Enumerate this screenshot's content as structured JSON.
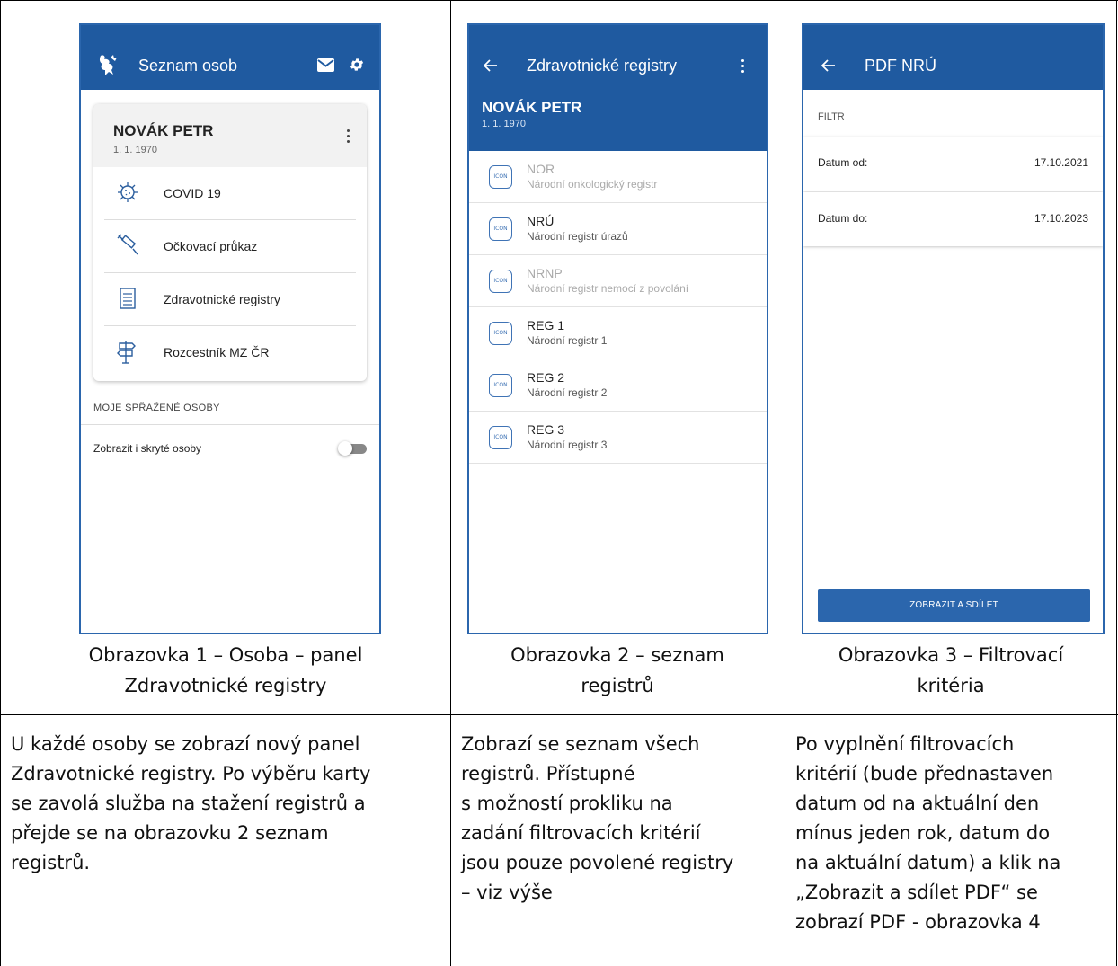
{
  "screen1": {
    "appbar_title": "Seznam osob",
    "logo_icon": "coat-of-arms-icon",
    "person_name": "NOVÁK PETR",
    "person_date": "1. 1. 1970",
    "menu": [
      {
        "label": "COVID 19",
        "icon": "virus-icon"
      },
      {
        "label": "Očkovací průkaz",
        "icon": "syringe-icon"
      },
      {
        "label": "Zdravotnické registry",
        "icon": "document-icon"
      },
      {
        "label": "Rozcestník MZ ČR",
        "icon": "signpost-icon"
      }
    ],
    "section_label": "MOJE SPŘAŽENÉ OSOBY",
    "toggle_label": "Zobrazit i skryté osoby",
    "toggle_on": false
  },
  "screen2": {
    "appbar_title": "Zdravotnické registry",
    "person_name": "NOVÁK PETR",
    "person_date": "1. 1. 1970",
    "icon_text": "ICON",
    "registries": [
      {
        "code": "NOR",
        "name": "Národní onkologický registr",
        "enabled": false
      },
      {
        "code": "NRÚ",
        "name": "Národní registr úrazů",
        "enabled": true
      },
      {
        "code": "NRNP",
        "name": "Národní registr nemocí z povolání",
        "enabled": false
      },
      {
        "code": "REG 1",
        "name": "Národní registr 1",
        "enabled": true
      },
      {
        "code": "REG 2",
        "name": "Národní registr 2",
        "enabled": true
      },
      {
        "code": "REG 3",
        "name": "Národní registr 3",
        "enabled": true
      }
    ]
  },
  "screen3": {
    "appbar_title": "PDF NRÚ",
    "filter_label": "FILTR",
    "date_from_label": "Datum od:",
    "date_from_value": "17.10.2021",
    "date_to_label": "Datum do:",
    "date_to_value": "17.10.2023",
    "button_label": "ZOBRAZIT A SDÍLET"
  },
  "captions": {
    "c1_line1": "Obrazovka 1 – Osoba – panel",
    "c1_line2": "Zdravotnické registry",
    "c2_line1": "Obrazovka 2 – seznam",
    "c2_line2": "registrů",
    "c3_line1": "Obrazovka 3 – Filtrovací",
    "c3_line2": "kritéria"
  },
  "descriptions": {
    "d1": [
      "U každé osoby se zobrazí nový panel",
      "Zdravotnické registry. Po výběru karty",
      "se zavolá služba na stažení registrů a",
      "přejde se na obrazovku 2 seznam",
      "registrů."
    ],
    "d2": [
      "Zobrazí se seznam všech",
      "registrů. Přístupné",
      "s možností prokliku na",
      "zadání filtrovacích kritérií",
      "jsou pouze povolené registry",
      "– viz výše"
    ],
    "d3": [
      "Po vyplnění filtrovacích",
      "kritérií (bude přednastaven",
      "datum od na aktuální den",
      "mínus jeden rok, datum do",
      "na aktuální datum) a klik na",
      "„Zobrazit a sdílet PDF“ se",
      "zobrazí PDF - obrazovka 4"
    ]
  },
  "colors": {
    "appbar": "#1f5aa0",
    "frame": "#2b66ad",
    "button": "#2b66ad"
  }
}
